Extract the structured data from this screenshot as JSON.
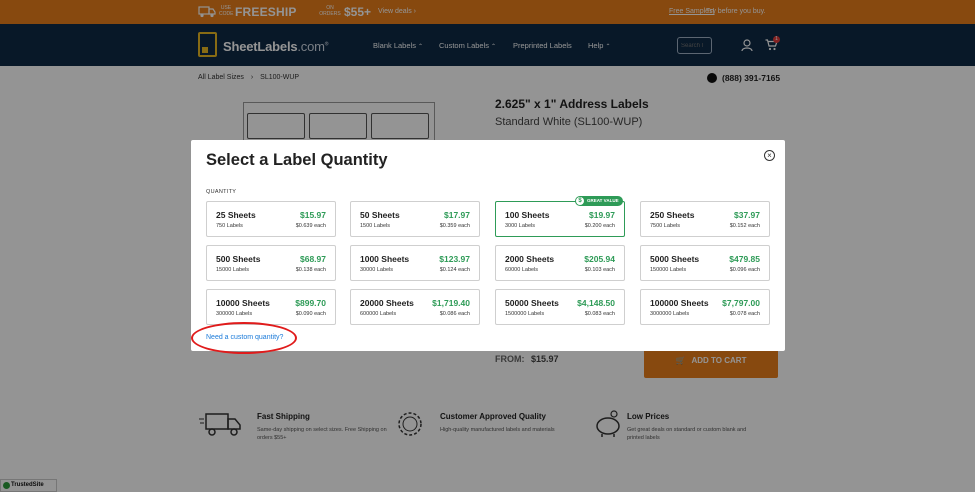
{
  "promo": {
    "use_code": "USE CODE",
    "code": "FREESHIP",
    "on_orders": "ON ORDERS",
    "amount": "$55+",
    "view_deals": "View deals ›",
    "free_samples": "Free Samples!",
    "try_before": "Try before you buy."
  },
  "nav": {
    "brand": "SheetLabels",
    "brand_suffix": ".com",
    "brand_reg": "®",
    "items": [
      {
        "label": "Blank Labels",
        "caret": true
      },
      {
        "label": "Custom Labels",
        "caret": true
      },
      {
        "label": "Preprinted Labels",
        "caret": false
      },
      {
        "label": "Help",
        "caret": true
      }
    ],
    "search_placeholder": "Search l",
    "cart_count": "1"
  },
  "breadcrumb": {
    "root": "All Label Sizes",
    "separator": "›",
    "current": "SL100-WUP"
  },
  "phone": "(888) 391-7165",
  "product": {
    "title": "2.625\" x 1\" Address Labels",
    "subtitle": "Standard White (SL100-WUP)",
    "from_label": "FROM:",
    "from_price": "$15.97",
    "add_to_cart": "ADD TO CART"
  },
  "features": [
    {
      "title": "Fast Shipping",
      "desc": "Same-day shipping on select sizes. Free Shipping on orders $55+",
      "icon": "truck-icon"
    },
    {
      "title": "Customer Approved Quality",
      "desc": "High-quality manufactured labels and materials",
      "icon": "quality-badge-icon"
    },
    {
      "title": "Low Prices",
      "desc": "Get great deals on standard or custom blank and printed labels",
      "icon": "piggy-bank-icon"
    }
  ],
  "trusted": "TrustedSite",
  "modal": {
    "title": "Select a Label Quantity",
    "quantity_label": "QUANTITY",
    "custom_link": "Need a custom quantity?",
    "badge": "GREAT VALUE",
    "options": [
      {
        "sheets": "25 Sheets",
        "labels": "750 Labels",
        "price": "$15.97",
        "each": "$0.639 each"
      },
      {
        "sheets": "50 Sheets",
        "labels": "1500 Labels",
        "price": "$17.97",
        "each": "$0.359 each"
      },
      {
        "sheets": "100 Sheets",
        "labels": "3000 Labels",
        "price": "$19.97",
        "each": "$0.200 each"
      },
      {
        "sheets": "250 Sheets",
        "labels": "7500 Labels",
        "price": "$37.97",
        "each": "$0.152 each"
      },
      {
        "sheets": "500 Sheets",
        "labels": "15000 Labels",
        "price": "$68.97",
        "each": "$0.138 each"
      },
      {
        "sheets": "1000 Sheets",
        "labels": "30000 Labels",
        "price": "$123.97",
        "each": "$0.124 each"
      },
      {
        "sheets": "2000 Sheets",
        "labels": "60000 Labels",
        "price": "$205.94",
        "each": "$0.103 each"
      },
      {
        "sheets": "5000 Sheets",
        "labels": "150000 Labels",
        "price": "$479.85",
        "each": "$0.096 each"
      },
      {
        "sheets": "10000 Sheets",
        "labels": "300000 Labels",
        "price": "$899.70",
        "each": "$0.090 each"
      },
      {
        "sheets": "20000 Sheets",
        "labels": "600000 Labels",
        "price": "$1,719.40",
        "each": "$0.086 each"
      },
      {
        "sheets": "50000 Sheets",
        "labels": "1500000 Labels",
        "price": "$4,148.50",
        "each": "$0.083 each"
      },
      {
        "sheets": "100000 Sheets",
        "labels": "3000000 Labels",
        "price": "$7,797.00",
        "each": "$0.078 each"
      }
    ]
  },
  "colors": {
    "promo_bg": "#e97e1b",
    "nav_bg": "#0e2a46",
    "price_green": "#2e9b57",
    "link_blue": "#1a7ad9",
    "annotation_red": "#e01b1b"
  }
}
